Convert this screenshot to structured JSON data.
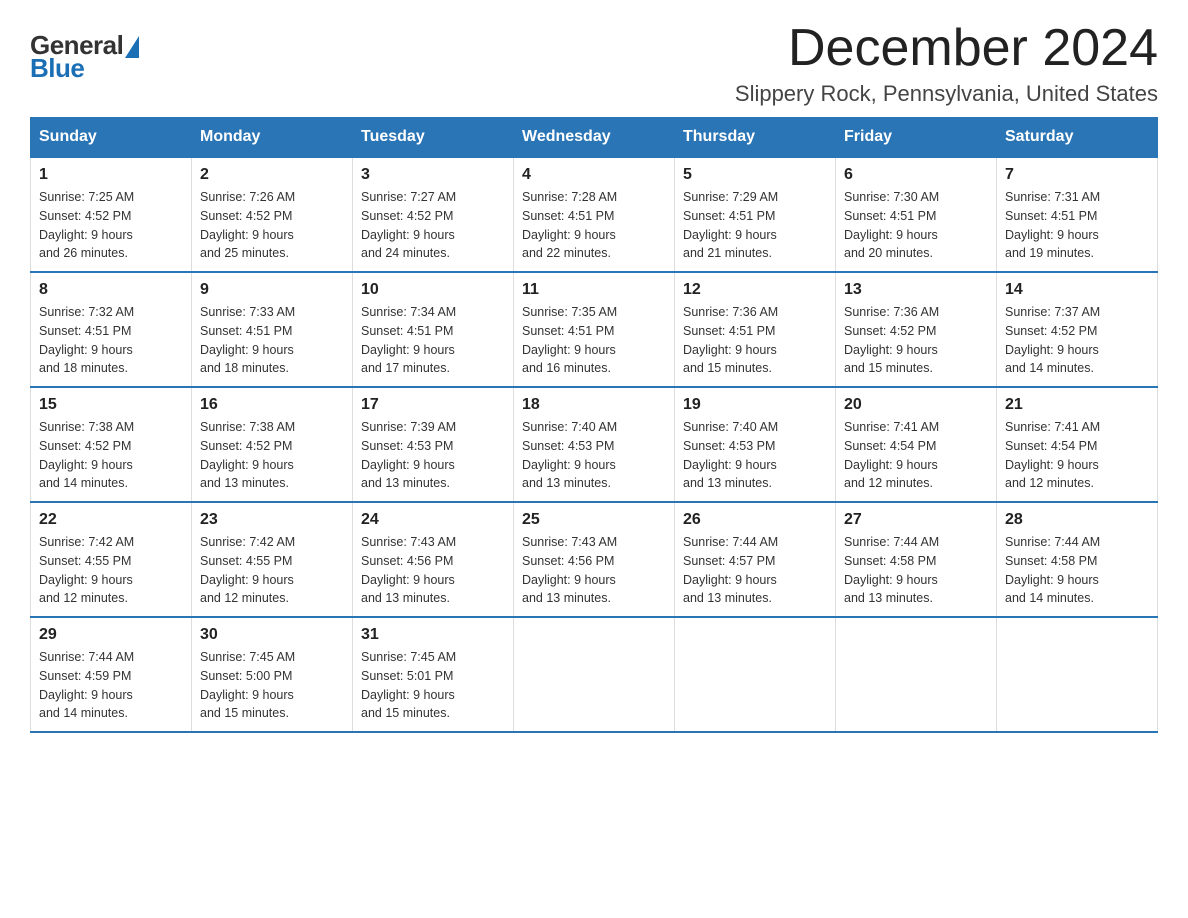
{
  "logo": {
    "general": "General",
    "blue": "Blue"
  },
  "title": {
    "month_year": "December 2024",
    "location": "Slippery Rock, Pennsylvania, United States"
  },
  "weekdays": [
    "Sunday",
    "Monday",
    "Tuesday",
    "Wednesday",
    "Thursday",
    "Friday",
    "Saturday"
  ],
  "weeks": [
    [
      {
        "day": "1",
        "sunrise": "7:25 AM",
        "sunset": "4:52 PM",
        "daylight": "9 hours and 26 minutes."
      },
      {
        "day": "2",
        "sunrise": "7:26 AM",
        "sunset": "4:52 PM",
        "daylight": "9 hours and 25 minutes."
      },
      {
        "day": "3",
        "sunrise": "7:27 AM",
        "sunset": "4:52 PM",
        "daylight": "9 hours and 24 minutes."
      },
      {
        "day": "4",
        "sunrise": "7:28 AM",
        "sunset": "4:51 PM",
        "daylight": "9 hours and 22 minutes."
      },
      {
        "day": "5",
        "sunrise": "7:29 AM",
        "sunset": "4:51 PM",
        "daylight": "9 hours and 21 minutes."
      },
      {
        "day": "6",
        "sunrise": "7:30 AM",
        "sunset": "4:51 PM",
        "daylight": "9 hours and 20 minutes."
      },
      {
        "day": "7",
        "sunrise": "7:31 AM",
        "sunset": "4:51 PM",
        "daylight": "9 hours and 19 minutes."
      }
    ],
    [
      {
        "day": "8",
        "sunrise": "7:32 AM",
        "sunset": "4:51 PM",
        "daylight": "9 hours and 18 minutes."
      },
      {
        "day": "9",
        "sunrise": "7:33 AM",
        "sunset": "4:51 PM",
        "daylight": "9 hours and 18 minutes."
      },
      {
        "day": "10",
        "sunrise": "7:34 AM",
        "sunset": "4:51 PM",
        "daylight": "9 hours and 17 minutes."
      },
      {
        "day": "11",
        "sunrise": "7:35 AM",
        "sunset": "4:51 PM",
        "daylight": "9 hours and 16 minutes."
      },
      {
        "day": "12",
        "sunrise": "7:36 AM",
        "sunset": "4:51 PM",
        "daylight": "9 hours and 15 minutes."
      },
      {
        "day": "13",
        "sunrise": "7:36 AM",
        "sunset": "4:52 PM",
        "daylight": "9 hours and 15 minutes."
      },
      {
        "day": "14",
        "sunrise": "7:37 AM",
        "sunset": "4:52 PM",
        "daylight": "9 hours and 14 minutes."
      }
    ],
    [
      {
        "day": "15",
        "sunrise": "7:38 AM",
        "sunset": "4:52 PM",
        "daylight": "9 hours and 14 minutes."
      },
      {
        "day": "16",
        "sunrise": "7:38 AM",
        "sunset": "4:52 PM",
        "daylight": "9 hours and 13 minutes."
      },
      {
        "day": "17",
        "sunrise": "7:39 AM",
        "sunset": "4:53 PM",
        "daylight": "9 hours and 13 minutes."
      },
      {
        "day": "18",
        "sunrise": "7:40 AM",
        "sunset": "4:53 PM",
        "daylight": "9 hours and 13 minutes."
      },
      {
        "day": "19",
        "sunrise": "7:40 AM",
        "sunset": "4:53 PM",
        "daylight": "9 hours and 13 minutes."
      },
      {
        "day": "20",
        "sunrise": "7:41 AM",
        "sunset": "4:54 PM",
        "daylight": "9 hours and 12 minutes."
      },
      {
        "day": "21",
        "sunrise": "7:41 AM",
        "sunset": "4:54 PM",
        "daylight": "9 hours and 12 minutes."
      }
    ],
    [
      {
        "day": "22",
        "sunrise": "7:42 AM",
        "sunset": "4:55 PM",
        "daylight": "9 hours and 12 minutes."
      },
      {
        "day": "23",
        "sunrise": "7:42 AM",
        "sunset": "4:55 PM",
        "daylight": "9 hours and 12 minutes."
      },
      {
        "day": "24",
        "sunrise": "7:43 AM",
        "sunset": "4:56 PM",
        "daylight": "9 hours and 13 minutes."
      },
      {
        "day": "25",
        "sunrise": "7:43 AM",
        "sunset": "4:56 PM",
        "daylight": "9 hours and 13 minutes."
      },
      {
        "day": "26",
        "sunrise": "7:44 AM",
        "sunset": "4:57 PM",
        "daylight": "9 hours and 13 minutes."
      },
      {
        "day": "27",
        "sunrise": "7:44 AM",
        "sunset": "4:58 PM",
        "daylight": "9 hours and 13 minutes."
      },
      {
        "day": "28",
        "sunrise": "7:44 AM",
        "sunset": "4:58 PM",
        "daylight": "9 hours and 14 minutes."
      }
    ],
    [
      {
        "day": "29",
        "sunrise": "7:44 AM",
        "sunset": "4:59 PM",
        "daylight": "9 hours and 14 minutes."
      },
      {
        "day": "30",
        "sunrise": "7:45 AM",
        "sunset": "5:00 PM",
        "daylight": "9 hours and 15 minutes."
      },
      {
        "day": "31",
        "sunrise": "7:45 AM",
        "sunset": "5:01 PM",
        "daylight": "9 hours and 15 minutes."
      },
      null,
      null,
      null,
      null
    ]
  ],
  "labels": {
    "sunrise": "Sunrise:",
    "sunset": "Sunset:",
    "daylight": "Daylight:"
  }
}
